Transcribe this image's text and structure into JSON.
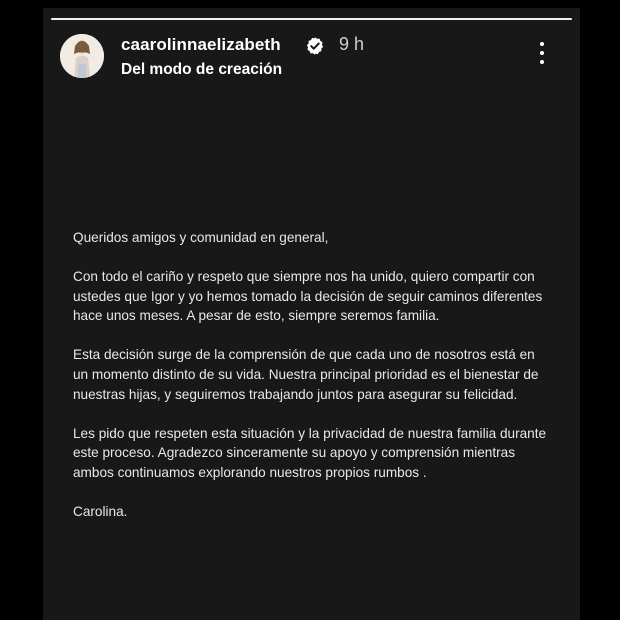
{
  "story": {
    "progress": 1.0,
    "username": "caarolinnaelizabeth",
    "verified_icon": "verified-badge-icon",
    "time": "9 h",
    "subtitle": "Del modo de creación",
    "menu_icon": "more-vertical-icon"
  },
  "letter": {
    "greeting": "Queridos amigos y comunidad en general,",
    "paragraphs": [
      "Con todo el cariño y respeto que siempre nos ha unido, quiero compartir con ustedes que Igor y yo hemos tomado la decisión de seguir caminos diferentes hace unos meses. A pesar de esto, siempre seremos familia.",
      "Esta decisión surge de la comprensión de que cada uno de nosotros está en un momento distinto de su vida. Nuestra principal prioridad es el bienestar de nuestras hijas, y seguiremos trabajando juntos para asegurar su felicidad.",
      "Les pido que respeten esta situación  y la privacidad de nuestra familia durante este proceso. Agradezco sinceramente su apoyo y comprensión mientras ambos continuamos explorando nuestros propios rumbos ."
    ],
    "signature": "Carolina."
  }
}
